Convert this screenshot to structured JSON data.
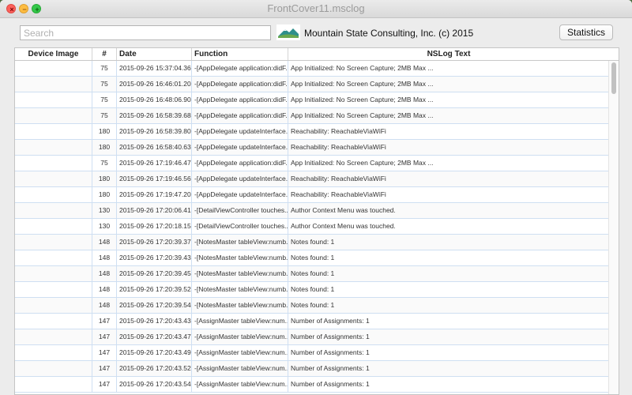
{
  "window": {
    "title": "FrontCover11.msclog"
  },
  "toolbar": {
    "search_placeholder": "Search",
    "search_value": "",
    "company": "Mountain State Consulting, Inc. (c) 2015",
    "stats_label": "Statistics"
  },
  "table": {
    "headers": [
      "Device Image",
      "#",
      "Date",
      "Function",
      "NSLog Text"
    ],
    "rows": [
      {
        "num": "75",
        "date": "2015-09-26 15:37:04.362",
        "func": "-[AppDelegate application:didF...",
        "text": "App Initialized: No Screen Capture; 2MB Max ..."
      },
      {
        "num": "75",
        "date": "2015-09-26 16:46:01.201",
        "func": "-[AppDelegate application:didF...",
        "text": "App Initialized: No Screen Capture; 2MB Max ..."
      },
      {
        "num": "75",
        "date": "2015-09-26 16:48:06.908",
        "func": "-[AppDelegate application:didF...",
        "text": "App Initialized: No Screen Capture; 2MB Max ..."
      },
      {
        "num": "75",
        "date": "2015-09-26 16:58:39.680",
        "func": "-[AppDelegate application:didF...",
        "text": "App Initialized: No Screen Capture; 2MB Max ..."
      },
      {
        "num": "180",
        "date": "2015-09-26 16:58:39.802",
        "func": "-[AppDelegate updateInterface...",
        "text": "Reachability: ReachableViaWiFi"
      },
      {
        "num": "180",
        "date": "2015-09-26 16:58:40.634",
        "func": "-[AppDelegate updateInterface...",
        "text": "Reachability: ReachableViaWiFi"
      },
      {
        "num": "75",
        "date": "2015-09-26 17:19:46.470",
        "func": "-[AppDelegate application:didF...",
        "text": "App Initialized: No Screen Capture; 2MB Max ..."
      },
      {
        "num": "180",
        "date": "2015-09-26 17:19:46.566",
        "func": "-[AppDelegate updateInterface...",
        "text": "Reachability: ReachableViaWiFi"
      },
      {
        "num": "180",
        "date": "2015-09-26 17:19:47.206",
        "func": "-[AppDelegate updateInterface...",
        "text": "Reachability: ReachableViaWiFi"
      },
      {
        "num": "130",
        "date": "2015-09-26 17:20:06.414",
        "func": "-[DetailViewController touches...",
        "text": "Author Context Menu was touched."
      },
      {
        "num": "130",
        "date": "2015-09-26 17:20:18.154",
        "func": "-[DetailViewController touches...",
        "text": "Author Context Menu was touched."
      },
      {
        "num": "148",
        "date": "2015-09-26 17:20:39.378",
        "func": "-[NotesMaster tableView:numb...",
        "text": "Notes found: 1"
      },
      {
        "num": "148",
        "date": "2015-09-26 17:20:39.434",
        "func": "-[NotesMaster tableView:numb...",
        "text": "Notes found: 1"
      },
      {
        "num": "148",
        "date": "2015-09-26 17:20:39.459",
        "func": "-[NotesMaster tableView:numb...",
        "text": "Notes found: 1"
      },
      {
        "num": "148",
        "date": "2015-09-26 17:20:39.523",
        "func": "-[NotesMaster tableView:numb...",
        "text": "Notes found: 1"
      },
      {
        "num": "148",
        "date": "2015-09-26 17:20:39.548",
        "func": "-[NotesMaster tableView:numb...",
        "text": "Notes found: 1"
      },
      {
        "num": "147",
        "date": "2015-09-26 17:20:43.434",
        "func": "-[AssignMaster tableView:num...",
        "text": "Number of Assignments: 1"
      },
      {
        "num": "147",
        "date": "2015-09-26 17:20:43.475",
        "func": "-[AssignMaster tableView:num...",
        "text": "Number of Assignments: 1"
      },
      {
        "num": "147",
        "date": "2015-09-26 17:20:43.495",
        "func": "-[AssignMaster tableView:num...",
        "text": "Number of Assignments: 1"
      },
      {
        "num": "147",
        "date": "2015-09-26 17:20:43.529",
        "func": "-[AssignMaster tableView:num...",
        "text": "Number of Assignments: 1"
      },
      {
        "num": "147",
        "date": "2015-09-26 17:20:43.545",
        "func": "-[AssignMaster tableView:num...",
        "text": "Number of Assignments: 1"
      }
    ]
  },
  "icons": {
    "close": "close-icon",
    "minimize": "minimize-icon",
    "maximize": "maximize-icon",
    "logo": "mountain-logo-icon"
  },
  "colors": {
    "close": "#fc605b",
    "minimize": "#fdbc40",
    "maximize": "#34c84a",
    "grid": "#cfdff2",
    "logo_teal": "#2f8f8b",
    "logo_green": "#6aa84f"
  }
}
